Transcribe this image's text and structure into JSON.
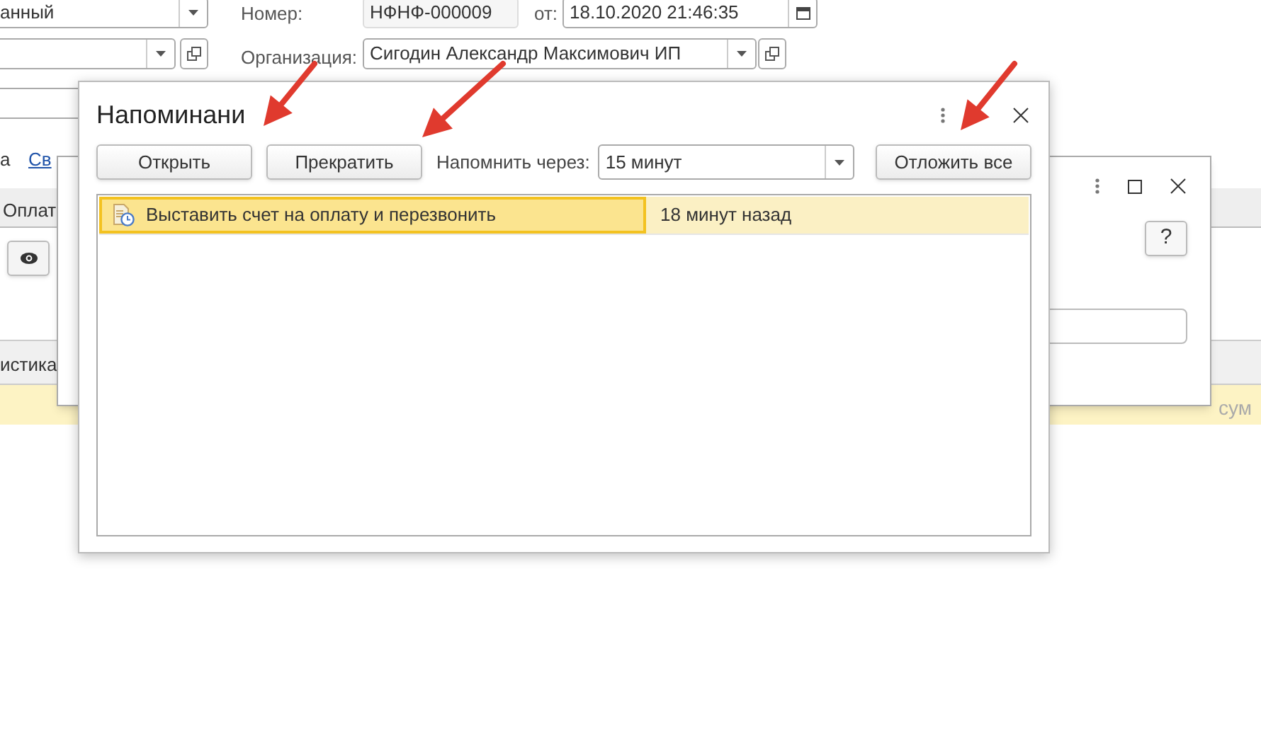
{
  "background_form": {
    "kind_field": {
      "value": "анный"
    },
    "number_label": "Номер:",
    "number_field": {
      "value": "НФНФ-000009"
    },
    "date_label": "от:",
    "date_field": {
      "value": "18.10.2020 21:46:35"
    },
    "organization_label": "Организация:",
    "organization_field": {
      "value": "Сигодин Александр Максимович ИП"
    },
    "text_1": "а",
    "link": "Св",
    "tab": "Оплат",
    "table_header": "истика",
    "table_cell": "сум"
  },
  "back_dialog": {
    "help_button": "?"
  },
  "dialog": {
    "title": "Напоминани",
    "buttons": [
      "Открыть",
      "Прекратить"
    ],
    "remind_label": "Напомнить через:",
    "remind_field": {
      "value": "15 минут"
    },
    "postpone_button": "Отложить все",
    "rows": [
      {
        "subject": "Выставить счет на оплату и перезвонить",
        "time": "18 минут назад",
        "selected": true
      }
    ]
  },
  "annotations": [
    {
      "kind": "arrow"
    },
    {
      "kind": "arrow"
    },
    {
      "kind": "arrow"
    }
  ]
}
